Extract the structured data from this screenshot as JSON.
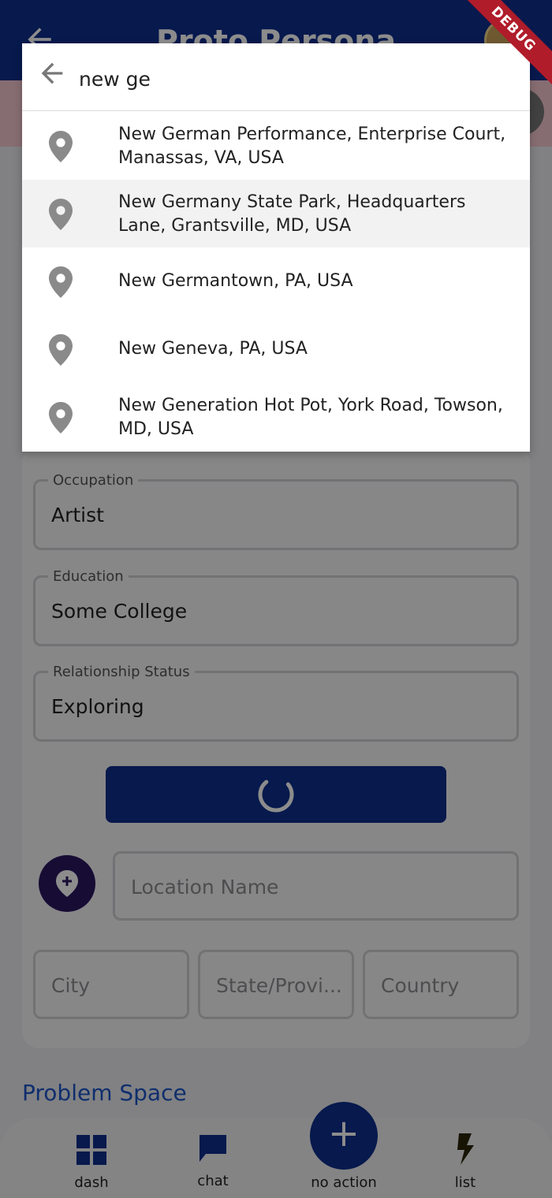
{
  "app_bar": {
    "title": "Proto Persona",
    "debug_banner": "DEBUG"
  },
  "search": {
    "query": "new ge",
    "results": [
      {
        "label": "New German Performance, Enterprise Court, Manassas, VA, USA"
      },
      {
        "label": "New Germany State Park, Headquarters Lane, Grantsville, MD, USA"
      },
      {
        "label": "New Germantown, PA, USA"
      },
      {
        "label": "New Geneva, PA, USA"
      },
      {
        "label": "New Generation Hot Pot, York Road, Towson, MD, USA"
      }
    ]
  },
  "form": {
    "occupation": {
      "label": "Occupation",
      "value": "Artist"
    },
    "education": {
      "label": "Education",
      "value": "Some College"
    },
    "relationship": {
      "label": "Relationship Status",
      "value": "Exploring"
    },
    "location_name_placeholder": "Location Name",
    "city_placeholder": "City",
    "state_placeholder": "State/Provi...",
    "country_placeholder": "Country"
  },
  "section": {
    "problem_space": "Problem Space"
  },
  "bottom_nav": {
    "dash": "dash",
    "chat": "chat",
    "no_action": "no action",
    "list": "list",
    "fab_symbol": "+"
  },
  "colors": {
    "primary": "#0d2f8c",
    "accent_blue": "#1c55c7",
    "location_fab": "#2a1660",
    "debug": "#b01c2a"
  }
}
